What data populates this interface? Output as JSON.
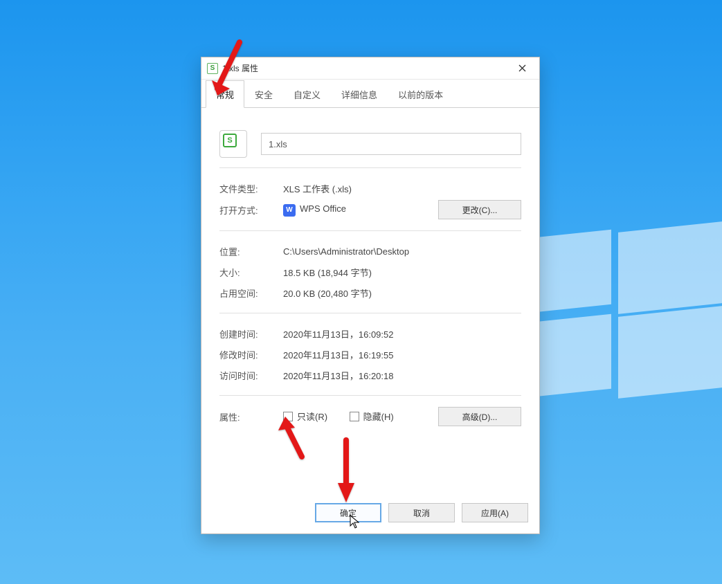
{
  "window": {
    "title": "1.xls 属性"
  },
  "tabs": [
    "常规",
    "安全",
    "自定义",
    "详细信息",
    "以前的版本"
  ],
  "filename": "1.xls",
  "labels": {
    "file_type": "文件类型:",
    "open_with": "打开方式:",
    "location": "位置:",
    "size": "大小:",
    "disk_size": "占用空间:",
    "created": "创建时间:",
    "modified": "修改时间:",
    "accessed": "访问时间:",
    "attributes": "属性:"
  },
  "values": {
    "file_type": "XLS 工作表 (.xls)",
    "open_with": "WPS Office",
    "location": "C:\\Users\\Administrator\\Desktop",
    "size": "18.5 KB (18,944 字节)",
    "disk_size": "20.0 KB (20,480 字节)",
    "created": "2020年11月13日，16:09:52",
    "modified": "2020年11月13日，16:19:55",
    "accessed": "2020年11月13日，16:20:18"
  },
  "buttons": {
    "change": "更改(C)...",
    "advanced": "高级(D)...",
    "ok": "确定",
    "cancel": "取消",
    "apply": "应用(A)"
  },
  "checkboxes": {
    "readonly": "只读(R)",
    "hidden": "隐藏(H)"
  },
  "icons": {
    "wps_badge": "W",
    "file_badge": "S"
  }
}
